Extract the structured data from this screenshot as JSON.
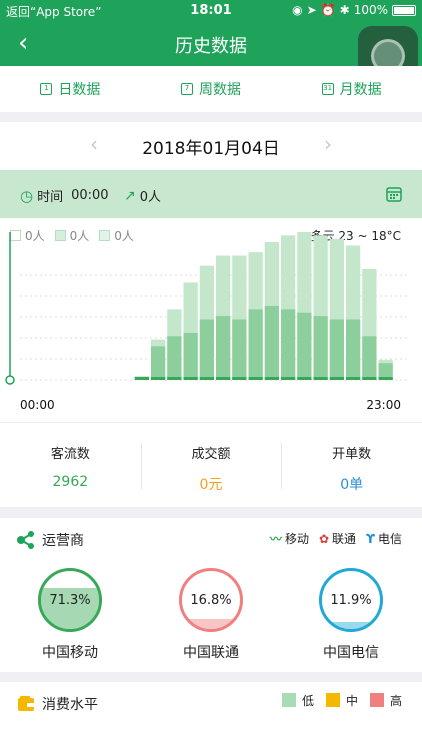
{
  "status_bar": {
    "back_app": "返回“App Store”",
    "time": "18:01",
    "battery": "100%"
  },
  "nav": {
    "title": "历史数据"
  },
  "tabs": [
    {
      "label": "日数据",
      "icon": "1"
    },
    {
      "label": "周数据",
      "icon": "7"
    },
    {
      "label": "月数据",
      "icon": "31"
    }
  ],
  "date": {
    "value": "2018年01月04日"
  },
  "summary": {
    "time_label": "时间",
    "time_value": "00:00",
    "people": "0人"
  },
  "legend": {
    "a": "0人",
    "b": "0人",
    "c": "0人"
  },
  "weather": "多云   23 ~ 18°C",
  "time_axis": {
    "start": "00:00",
    "end": "23:00"
  },
  "chart_data": {
    "type": "bar",
    "title": "",
    "categories": [
      "00",
      "01",
      "02",
      "03",
      "04",
      "05",
      "06",
      "07",
      "08",
      "09",
      "10",
      "11",
      "12",
      "13",
      "14",
      "15",
      "16",
      "17",
      "18",
      "19",
      "20",
      "21",
      "22",
      "23"
    ],
    "series": [
      {
        "values": [
          0,
          0,
          0,
          0,
          0,
          0,
          0,
          1,
          10,
          13,
          14,
          18,
          19,
          18,
          21,
          22,
          21,
          20,
          19,
          18,
          18,
          13,
          5,
          0
        ]
      },
      {
        "values": [
          0,
          0,
          0,
          0,
          0,
          0,
          0,
          1,
          12,
          21,
          29,
          34,
          37,
          37,
          38,
          41,
          43,
          44,
          43,
          42,
          40,
          33,
          6,
          0
        ]
      }
    ],
    "colors": {
      "light": "#c4e6cb",
      "mid": "#8ccf9c",
      "dark": "#37a857"
    }
  },
  "stats": [
    {
      "label": "客流数",
      "value": "2962",
      "color": "#37a857"
    },
    {
      "label": "成交额",
      "value": "0元",
      "color": "#f1a11a"
    },
    {
      "label": "开单数",
      "value": "0单",
      "color": "#2a8fd6"
    }
  ],
  "carrier": {
    "title": "运营商",
    "legend": [
      {
        "icon": "〰",
        "label": "移动",
        "color": "#37a857"
      },
      {
        "icon": "✿",
        "label": "联通",
        "color": "#e23a3a"
      },
      {
        "icon": "ϒ",
        "label": "电信",
        "color": "#1a8fd1"
      }
    ],
    "gauges": [
      {
        "label": "中国移动",
        "percent": "71.3%",
        "fraction": 0.713,
        "color": "#37a857"
      },
      {
        "label": "中国联通",
        "percent": "16.8%",
        "fraction": 0.168,
        "color": "#f07f7f"
      },
      {
        "label": "中国电信",
        "percent": "11.9%",
        "fraction": 0.119,
        "color": "#1fa8d8"
      }
    ]
  },
  "consumption": {
    "title": "消费水平",
    "levels": [
      {
        "label": "低",
        "color": "#a7dcb4"
      },
      {
        "label": "中",
        "color": "#f5b800"
      },
      {
        "label": "高",
        "color": "#f07f7f"
      }
    ]
  }
}
